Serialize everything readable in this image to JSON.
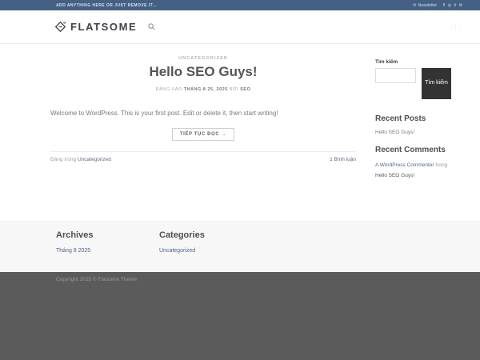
{
  "colors": {
    "topbar_bg": "#446084",
    "accent": "#446084",
    "dark_button": "#333333",
    "footer_bg": "#f7f7f7",
    "absfooter_bg": "#5b5b5b"
  },
  "topbar": {
    "left_text": "ADD ANYTHING HERE OR JUST REMOVE IT...",
    "newsletter_glyph": "✉",
    "newsletter_label": "Newsletter",
    "icons": [
      {
        "name": "facebook",
        "glyph": "f"
      },
      {
        "name": "instagram",
        "glyph": "◎"
      },
      {
        "name": "twitter",
        "glyph": "t"
      },
      {
        "name": "email",
        "glyph": "✉"
      }
    ]
  },
  "header": {
    "logo_text": "FLATSOME",
    "arrow_left": "‹",
    "arrow_right": "›"
  },
  "post": {
    "category": "UNCATEGORIZED",
    "title": "Hello SEO Guys!",
    "meta_prefix": "ĐĂNG VÀO",
    "meta_date": "THÁNG 8 25, 2025",
    "meta_by": "BỞI",
    "meta_author": "SEO",
    "excerpt": "Welcome to WordPress. This is your first post. Edit or delete it, then start writing!",
    "read_more_label": "TIẾP TỤC ĐỌC →",
    "posted_in_prefix": "Đăng trong",
    "posted_in_category": "Uncategorized",
    "comments_label": "1 Bình luận"
  },
  "sidebar": {
    "search_label": "Tìm kiếm",
    "search_button_label": "Tìm kiếm",
    "search_value": "",
    "recent_posts_title": "Recent Posts",
    "recent_posts": [
      {
        "label": "Hello SEO Guys!"
      }
    ],
    "recent_comments_title": "Recent Comments",
    "recent_comments": [
      {
        "author": "A WordPress Commenter",
        "prefix": "trong",
        "post": "Hello SEO Guys!"
      }
    ]
  },
  "footer": {
    "archives_title": "Archives",
    "archives": [
      {
        "label": "Tháng 8 2025"
      }
    ],
    "categories_title": "Categories",
    "categories": [
      {
        "label": "Uncategorized"
      }
    ],
    "copyright": "Copyright 2025 © Flatsome Theme"
  }
}
